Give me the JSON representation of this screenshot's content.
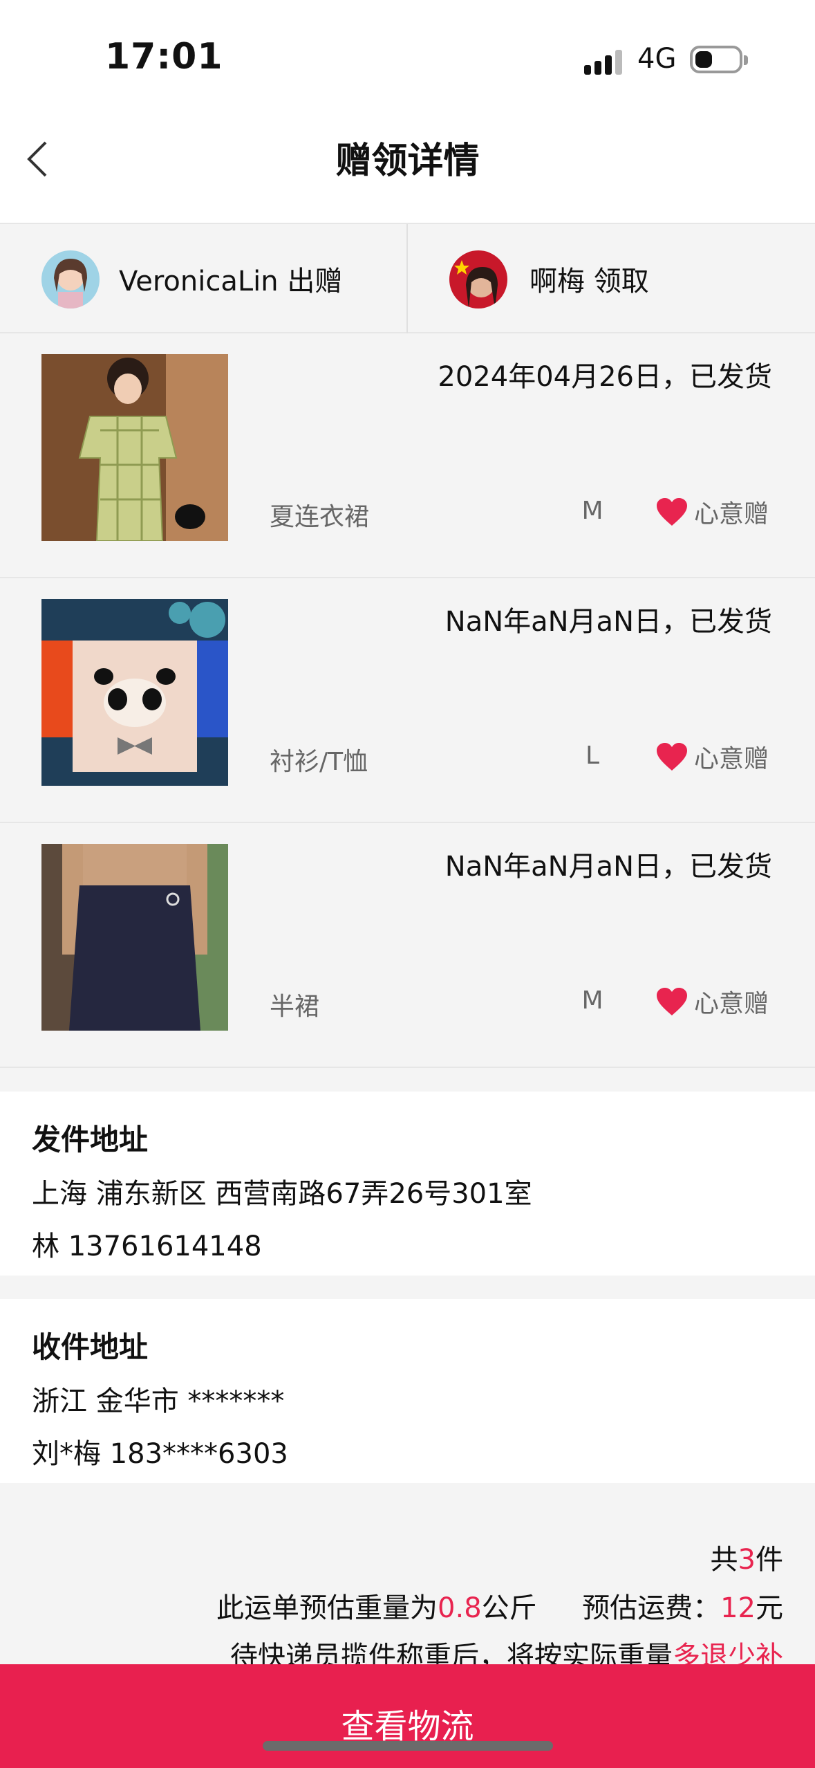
{
  "status_bar": {
    "time": "17:01",
    "network": "4G"
  },
  "nav": {
    "title": "赠领详情"
  },
  "participants": {
    "giver": {
      "label": "VeronicaLin 出赠"
    },
    "receiver": {
      "label": "啊梅 领取"
    }
  },
  "items": [
    {
      "status": "2024年04月26日，已发货",
      "category": "夏连衣裙",
      "size": "M",
      "tag": "心意赠"
    },
    {
      "status": "NaN年aN月aN日，已发货",
      "category": "衬衫/T恤",
      "size": "L",
      "tag": "心意赠"
    },
    {
      "status": "NaN年aN月aN日，已发货",
      "category": "半裙",
      "size": "M",
      "tag": "心意赠"
    }
  ],
  "sender_address": {
    "title": "发件地址",
    "address": "上海 浦东新区 西营南路67弄26号301室",
    "contact": "林 13761614148"
  },
  "receiver_address": {
    "title": "收件地址",
    "address": "浙江 金华市 *******",
    "contact": "刘*梅 183****6303"
  },
  "summary": {
    "count_prefix": "共",
    "count": "3",
    "count_suffix": "件",
    "weight_prefix": "此运单预估重量为",
    "weight": "0.8",
    "weight_suffix": "公斤",
    "fee_prefix": "预估运费：",
    "fee": "12",
    "fee_suffix": "元",
    "note_prefix": "待快递员揽件称重后，将按实际重量",
    "note_highlight": "多退少补"
  },
  "bottom_button": {
    "label": "查看物流"
  },
  "colors": {
    "accent": "#e8204f",
    "heart": "#e8244f"
  }
}
